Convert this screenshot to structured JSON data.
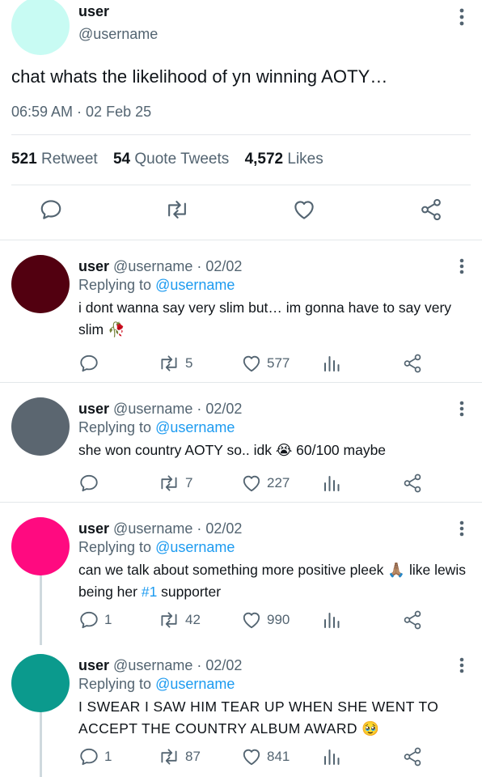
{
  "colors": {
    "accent": "#1d9bf0",
    "text": "#0f1419",
    "muted": "#536471",
    "divider": "#e3e7ea"
  },
  "main": {
    "avatar_color": "#c8fbf3",
    "name": "user",
    "handle": "@username",
    "text": "chat whats the likelihood of yn winning AOTY…",
    "time": "06:59 AM · 02 Feb 25",
    "stats": {
      "retweets_count": "521",
      "retweets_label": "Retweet",
      "quotes_count": "54",
      "quotes_label": "Quote Tweets",
      "likes_count": "4,572",
      "likes_label": "Likes"
    }
  },
  "replies": [
    {
      "avatar_color": "#520010",
      "name": "user",
      "meta": "@username · 02/02",
      "replying_prefix": "Replying to",
      "replying_to": "@username",
      "text": "i dont wanna say very slim but… im gonna have to say very slim 🥀",
      "replies": "",
      "retweets": "5",
      "likes": "577"
    },
    {
      "avatar_color": "#5b6670",
      "name": "user",
      "meta": "@username · 02/02",
      "replying_prefix": "Replying to",
      "replying_to": "@username",
      "text": "she won country AOTY so.. idk 😭  60/100 maybe",
      "replies": "",
      "retweets": "7",
      "likes": "227"
    },
    {
      "avatar_color": "#ff0a80",
      "name": "user",
      "meta": "@username · 02/02",
      "replying_prefix": "Replying to",
      "replying_to": "@username",
      "text_before": "can we talk about something more positive pleek 🙏🏽  like lewis being her ",
      "hashtag": "#1",
      "text_after": " supporter",
      "replies": "1",
      "retweets": "42",
      "likes": "990"
    },
    {
      "avatar_color": "#0b9a8d",
      "name": "user",
      "meta": "@username · 02/02",
      "replying_prefix": "Replying to",
      "replying_to": "@username",
      "text": "I SWEAR I SAW HIM TEAR UP WHEN SHE WENT TO ACCEPT THE COUNTRY ALBUM AWARD 🥹",
      "replies": "1",
      "retweets": "87",
      "likes": "841"
    }
  ]
}
